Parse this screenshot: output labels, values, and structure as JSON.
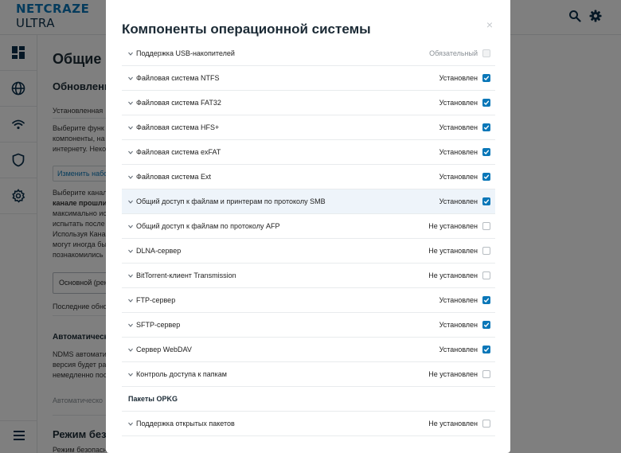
{
  "app": {
    "logo_line1": "NETCRAZE",
    "logo_line2": "ULTRA"
  },
  "background": {
    "page_title": "Общие н",
    "updates_heading": "Обновлени",
    "installed_text": "Установленная",
    "select_text": [
      "Выберите функ",
      "компоненты, на",
      "интернету. Неко"
    ],
    "change_button": "Изменить набо",
    "channel_text": [
      "Выберите канал",
      "канале прошли",
      "максимально ис",
      "испытать после",
      "Используя Кана",
      "могут иногда бы",
      "познакомились"
    ],
    "channel_select": "Основной (рек",
    "last_updates": "Последние обно",
    "auto_heading": "Автоматическ",
    "auto_text": [
      "NDMS автомати",
      "версия будет ра",
      "немедленно пос"
    ],
    "auto_note": "Автоматическо",
    "safe_heading": "Режим безо",
    "safe_text": "Режим безопасн"
  },
  "dialog": {
    "title": "Компоненты операционной системы",
    "close": "×",
    "rows": [
      {
        "label": "Поддержка USB-накопителей",
        "status": "Обязательный",
        "checked": true,
        "disabled": true
      },
      {
        "label": "Файловая система NTFS",
        "status": "Установлен",
        "checked": true
      },
      {
        "label": "Файловая система FAT32",
        "status": "Установлен",
        "checked": true
      },
      {
        "label": "Файловая система HFS+",
        "status": "Установлен",
        "checked": true
      },
      {
        "label": "Файловая система exFAT",
        "status": "Установлен",
        "checked": true
      },
      {
        "label": "Файловая система Ext",
        "status": "Установлен",
        "checked": true
      },
      {
        "label": "Общий доступ к файлам и принтерам по протоколу SMB",
        "status": "Установлен",
        "checked": true,
        "highlighted": true
      },
      {
        "label": "Общий доступ к файлам по протоколу AFP",
        "status": "Не установлен",
        "checked": false
      },
      {
        "label": "DLNA-сервер",
        "status": "Не установлен",
        "checked": false
      },
      {
        "label": "BitTorrent-клиент Transmission",
        "status": "Не установлен",
        "checked": false
      },
      {
        "label": "FTP-сервер",
        "status": "Установлен",
        "checked": true
      },
      {
        "label": "SFTP-сервер",
        "status": "Установлен",
        "checked": true
      },
      {
        "label": "Сервер WebDAV",
        "status": "Установлен",
        "checked": true
      },
      {
        "label": "Контроль доступа к папкам",
        "status": "Не установлен",
        "checked": false
      }
    ],
    "section_opkg": "Пакеты OPKG",
    "opkg_rows": [
      {
        "label": "Поддержка открытых пакетов",
        "status": "Не установлен",
        "checked": false
      }
    ]
  },
  "colors": {
    "accent": "#0a77b8",
    "logo_dark": "#0a2f4a"
  }
}
